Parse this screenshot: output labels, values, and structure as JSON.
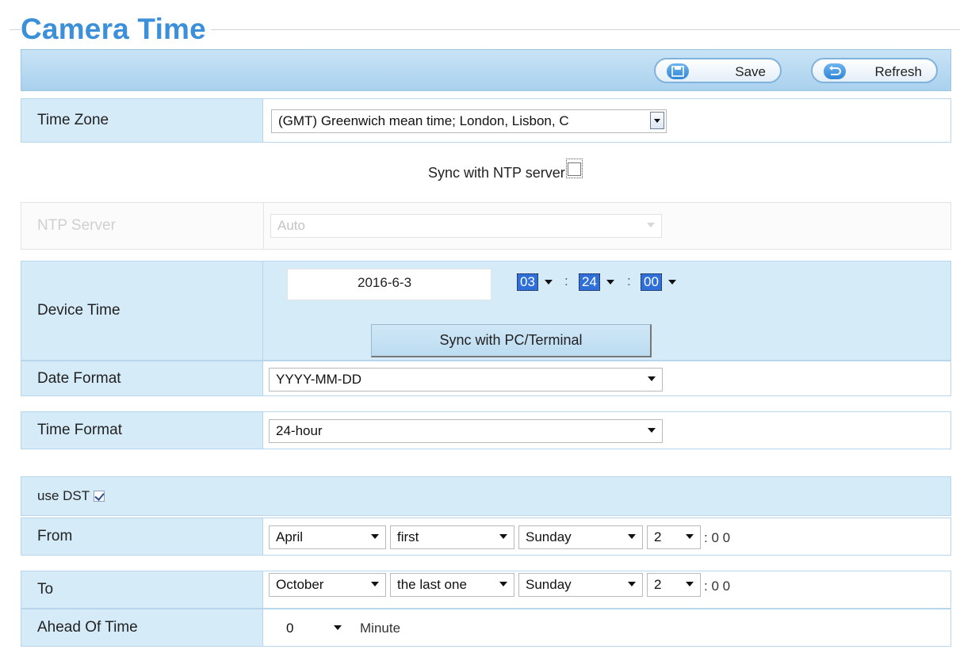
{
  "page": {
    "title": "Camera Time"
  },
  "toolbar": {
    "save_label": "Save",
    "refresh_label": "Refresh"
  },
  "time_zone": {
    "label": "Time Zone",
    "value": "(GMT) Greenwich mean time; London, Lisbon, C"
  },
  "ntp_sync": {
    "label": "Sync with NTP server",
    "checked": false
  },
  "ntp_server": {
    "label": "NTP Server",
    "value": "Auto"
  },
  "device_time": {
    "label": "Device Time",
    "date": "2016-6-3",
    "hour": "03",
    "minute": "24",
    "second": "00",
    "separator": ":",
    "sync_button": "Sync with PC/Terminal"
  },
  "date_format": {
    "label": "Date Format",
    "value": "YYYY-MM-DD"
  },
  "time_format": {
    "label": "Time Format",
    "value": "24-hour"
  },
  "dst": {
    "label": "use DST",
    "checked": true,
    "from": {
      "label": "From",
      "month": "April",
      "week": "first",
      "day": "Sunday",
      "hour": "2",
      "suffix": ": 0 0"
    },
    "to": {
      "label": "To",
      "month": "October",
      "week": "the last one",
      "day": "Sunday",
      "hour": "2",
      "suffix": ": 0 0"
    },
    "ahead": {
      "label": "Ahead Of Time",
      "value": "0",
      "unit": "Minute"
    }
  },
  "colors": {
    "accent": "#3c8fd9",
    "row_label_bg": "#d6ebf8",
    "border": "#b7d6ec"
  }
}
